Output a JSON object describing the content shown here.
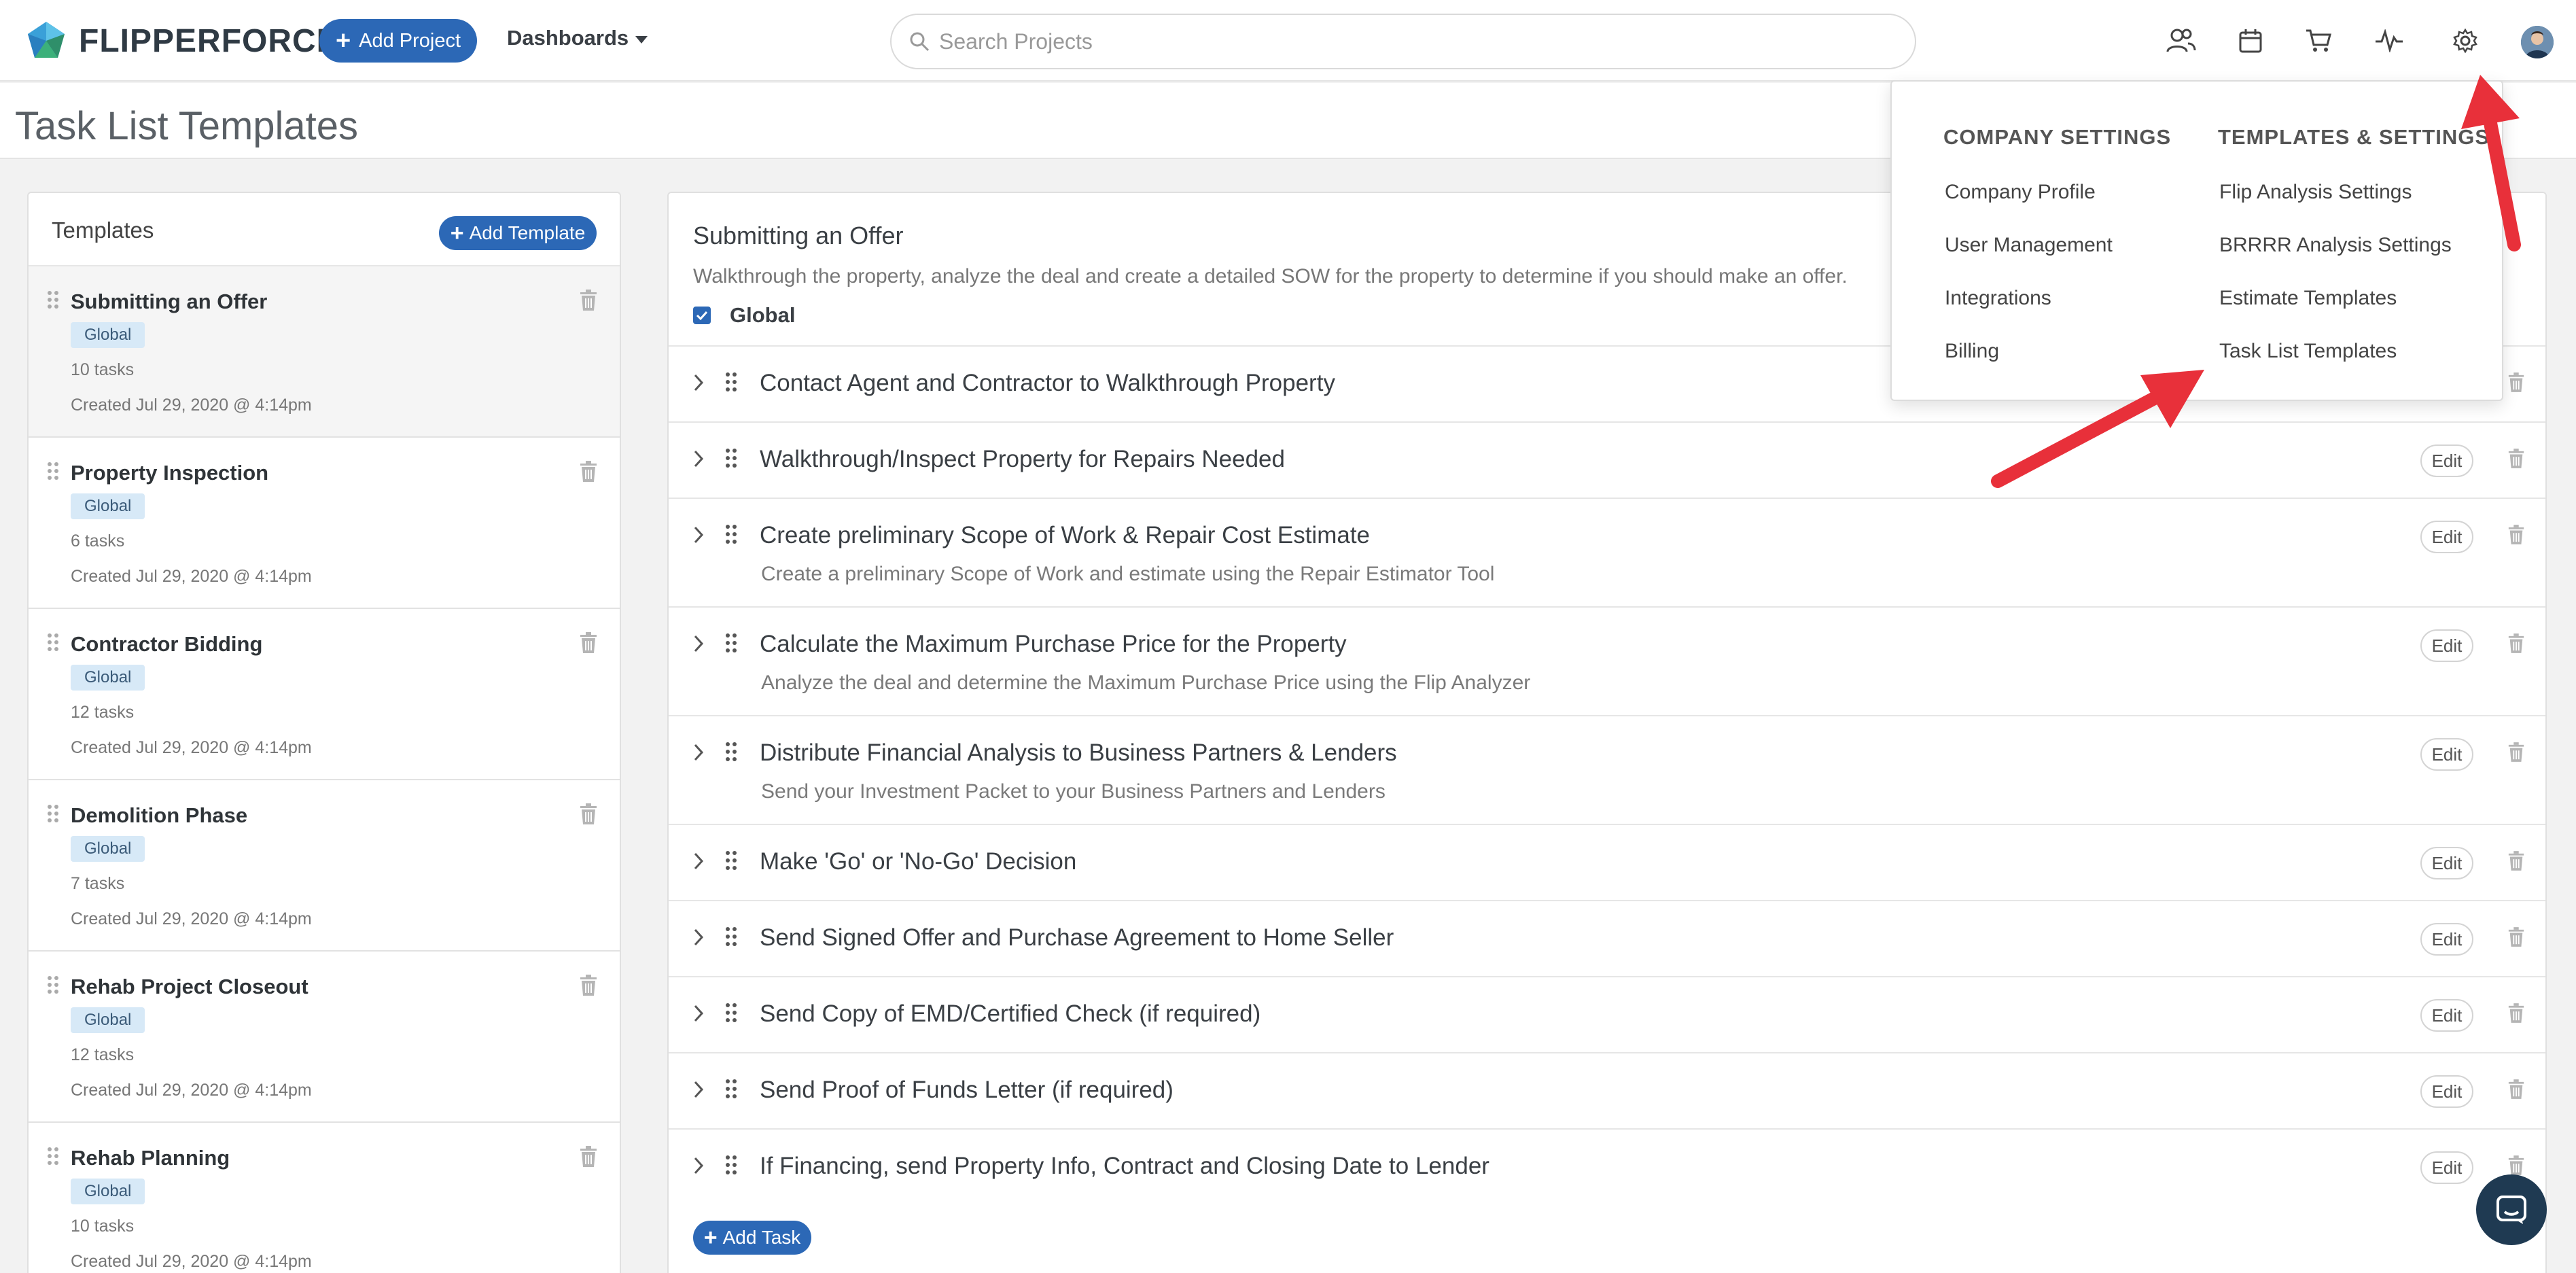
{
  "app": {
    "brand": "FLIPPERFORCE",
    "add_project_label": "Add Project",
    "dashboards_label": "Dashboards",
    "search_placeholder": "Search Projects"
  },
  "page": {
    "title": "Task List Templates"
  },
  "templates_panel": {
    "title": "Templates",
    "add_label": "Add Template",
    "items": [
      {
        "name": "Submitting an Offer",
        "badge": "Global",
        "count": "10 tasks",
        "created": "Created Jul 29, 2020 @ 4:14pm"
      },
      {
        "name": "Property Inspection",
        "badge": "Global",
        "count": "6 tasks",
        "created": "Created Jul 29, 2020 @ 4:14pm"
      },
      {
        "name": "Contractor Bidding",
        "badge": "Global",
        "count": "12 tasks",
        "created": "Created Jul 29, 2020 @ 4:14pm"
      },
      {
        "name": "Demolition Phase",
        "badge": "Global",
        "count": "7 tasks",
        "created": "Created Jul 29, 2020 @ 4:14pm"
      },
      {
        "name": "Rehab Project Closeout",
        "badge": "Global",
        "count": "12 tasks",
        "created": "Created Jul 29, 2020 @ 4:14pm"
      },
      {
        "name": "Rehab Planning",
        "badge": "Global",
        "count": "10 tasks",
        "created": "Created Jul 29, 2020 @ 4:14pm"
      }
    ]
  },
  "template_detail": {
    "title": "Submitting an Offer",
    "description": "Walkthrough the property, analyze the deal and create a detailed SOW for the property to determine if you should make an offer.",
    "global_label": "Global",
    "global_checked": true,
    "edit_label": "Edit",
    "add_task_label": "Add Task",
    "tasks": [
      {
        "title": "Contact Agent and Contractor to Walkthrough Property",
        "desc": ""
      },
      {
        "title": "Walkthrough/Inspect Property for Repairs Needed",
        "desc": ""
      },
      {
        "title": "Create preliminary Scope of Work & Repair Cost Estimate",
        "desc": "Create a preliminary Scope of Work and estimate using the Repair Estimator Tool"
      },
      {
        "title": "Calculate the Maximum Purchase Price for the Property",
        "desc": "Analyze the deal and determine the Maximum Purchase Price using the Flip Analyzer"
      },
      {
        "title": "Distribute Financial Analysis to Business Partners & Lenders",
        "desc": "Send your Investment Packet to your Business Partners and Lenders"
      },
      {
        "title": "Make 'Go' or 'No-Go' Decision",
        "desc": ""
      },
      {
        "title": "Send Signed Offer and Purchase Agreement to Home Seller",
        "desc": ""
      },
      {
        "title": "Send Copy of EMD/Certified Check (if required)",
        "desc": ""
      },
      {
        "title": "Send Proof of Funds Letter (if required)",
        "desc": ""
      },
      {
        "title": "If Financing, send Property Info, Contract and Closing Date to Lender",
        "desc": ""
      }
    ]
  },
  "settings_menu": {
    "company_heading": "COMPANY SETTINGS",
    "templates_heading": "TEMPLATES & SETTINGS",
    "company_items": [
      "Company Profile",
      "User Management",
      "Integrations",
      "Billing"
    ],
    "template_items": [
      "Flip Analysis Settings",
      "BRRRR Analysis Settings",
      "Estimate Templates",
      "Task List Templates"
    ]
  },
  "colors": {
    "primary": "#2c68b6",
    "badge_bg": "#d7e9f7",
    "annotation_arrow": "#e8303a",
    "chat_bg": "#1f3a52"
  },
  "icons": [
    "logo-icon",
    "plus-icon",
    "search-icon",
    "contacts-icon",
    "calendar-icon",
    "cart-icon",
    "activity-icon",
    "gear-icon",
    "avatar",
    "drag-handle-icon",
    "trash-icon",
    "chevron-right-icon",
    "checkbox-icon",
    "chat-icon"
  ]
}
